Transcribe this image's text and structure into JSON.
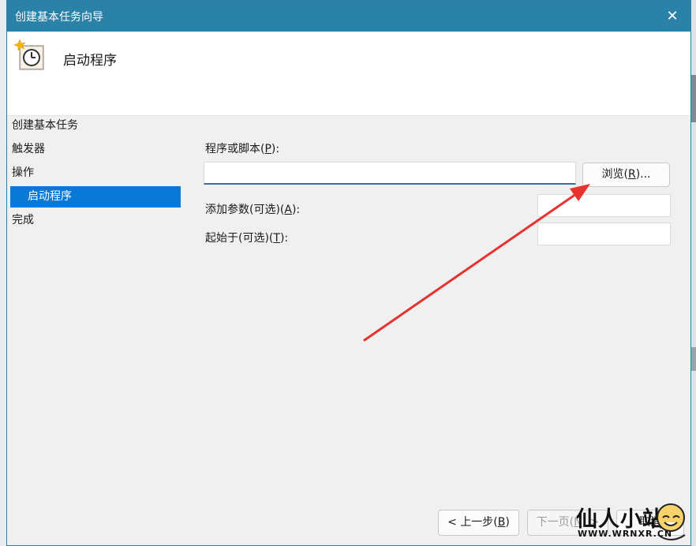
{
  "window": {
    "title": "创建基本任务向导",
    "close_glyph": "✕"
  },
  "header": {
    "title": "启动程序",
    "icon": "task-scheduler-clock-icon"
  },
  "sidebar": {
    "items": [
      {
        "label": "创建基本任务",
        "active": false
      },
      {
        "label": "触发器",
        "active": false
      },
      {
        "label": "操作",
        "active": false
      },
      {
        "label": "启动程序",
        "active": true
      },
      {
        "label": "完成",
        "active": false
      }
    ]
  },
  "form": {
    "program_label": "程序或脚本(",
    "program_key": "P",
    "program_label_end": "):",
    "program_value": "",
    "browse_label": "浏览(",
    "browse_key": "R",
    "browse_label_end": ")...",
    "args_label": "添加参数(可选)(",
    "args_key": "A",
    "args_label_end": "):",
    "args_value": "",
    "startin_label": "起始于(可选)(",
    "startin_key": "T",
    "startin_label_end": "):",
    "startin_value": ""
  },
  "footer": {
    "back_label": "< 上一步(",
    "back_key": "B",
    "back_label_end": ")",
    "next_label": "下一页(",
    "next_key": "N",
    "next_label_end": ") >",
    "cancel_label": "取消"
  },
  "annotation": {
    "arrow_color": "#e8322f"
  },
  "watermark": {
    "text": "仙人小站",
    "sub": "WWW.WRNXR.CN"
  },
  "colors": {
    "titlebar": "#2a82a8",
    "selection": "#0a78d7",
    "input_focus": "#2a6fb0"
  }
}
